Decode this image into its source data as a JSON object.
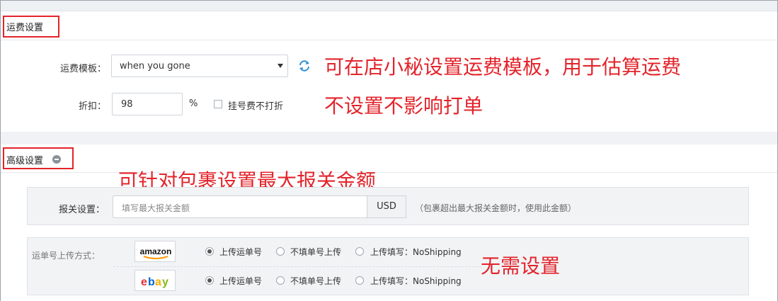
{
  "shipping_section": {
    "title": "运费设置",
    "template_label": "运费模板：",
    "template_value": "when you gone",
    "discount_label": "折扣：",
    "discount_value": "98",
    "percent": "%",
    "registered_no_discount": "挂号费不打折"
  },
  "advanced_section": {
    "title": "高级设置",
    "customs_label": "报关设置：",
    "customs_placeholder": "填写最大报关金额",
    "currency": "USD",
    "customs_hint": "（包裹超出最大报关金额时，使用此金额）",
    "upload_label": "运单号上传方式：",
    "platforms": [
      {
        "logo": "amazon",
        "options": [
          "上传运单号",
          "不填单号上传",
          "上传填写：NoShipping"
        ],
        "selected": 0
      },
      {
        "logo": "ebay",
        "options": [
          "上传运单号",
          "不填单号上传",
          "上传填写：NoShipping"
        ],
        "selected": 0
      }
    ]
  },
  "annotations": {
    "line1": "可在店小秘设置运费模板，用于估算运费",
    "line2": "不设置不影响打单",
    "line3": "可针对包裹设置最大报关金额",
    "line4": "无需设置"
  },
  "colors": {
    "annotation_red": "#e3242b",
    "refresh_blue": "#2f8fd8",
    "amazon_orange": "#ff9900",
    "ebay_red": "#e53238",
    "ebay_blue": "#0064d2",
    "ebay_yellow": "#f5af02",
    "ebay_green": "#86b817"
  }
}
